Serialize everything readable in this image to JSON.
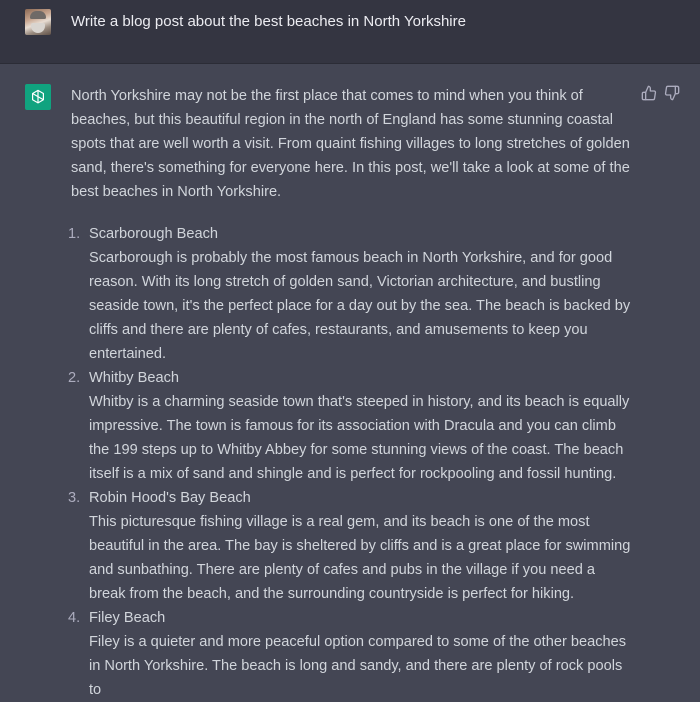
{
  "user_message": {
    "text": "Write a blog post about the best beaches in North Yorkshire"
  },
  "assistant_message": {
    "intro": "North Yorkshire may not be the first place that comes to mind when you think of beaches, but this beautiful region in the north of England has some stunning coastal spots that are well worth a visit. From quaint fishing villages to long stretches of golden sand, there's something for everyone here. In this post, we'll take a look at some of the best beaches in North Yorkshire.",
    "items": [
      {
        "number": "1.",
        "title": "Scarborough Beach",
        "body": "Scarborough is probably the most famous beach in North Yorkshire, and for good reason. With its long stretch of golden sand, Victorian architecture, and bustling seaside town, it's the perfect place for a day out by the sea. The beach is backed by cliffs and there are plenty of cafes, restaurants, and amusements to keep you entertained."
      },
      {
        "number": "2.",
        "title": "Whitby Beach",
        "body": "Whitby is a charming seaside town that's steeped in history, and its beach is equally impressive. The town is famous for its association with Dracula and you can climb the 199 steps up to Whitby Abbey for some stunning views of the coast. The beach itself is a mix of sand and shingle and is perfect for rockpooling and fossil hunting."
      },
      {
        "number": "3.",
        "title": "Robin Hood's Bay Beach",
        "body": "This picturesque fishing village is a real gem, and its beach is one of the most beautiful in the area. The bay is sheltered by cliffs and is a great place for swimming and sunbathing. There are plenty of cafes and pubs in the village if you need a break from the beach, and the surrounding countryside is perfect for hiking."
      },
      {
        "number": "4.",
        "title": "Filey Beach",
        "body": "Filey is a quieter and more peaceful option compared to some of the other beaches in North Yorkshire. The beach is long and sandy, and there are plenty of rock pools to"
      }
    ]
  },
  "icons": {
    "user_avatar": "user-avatar-photo",
    "assistant_avatar": "openai-logo-icon",
    "feedback": [
      "thumbs-up-icon",
      "thumbs-down-icon"
    ]
  },
  "colors": {
    "user_bg": "#343541",
    "assistant_bg": "#444654",
    "accent": "#10a37f"
  }
}
